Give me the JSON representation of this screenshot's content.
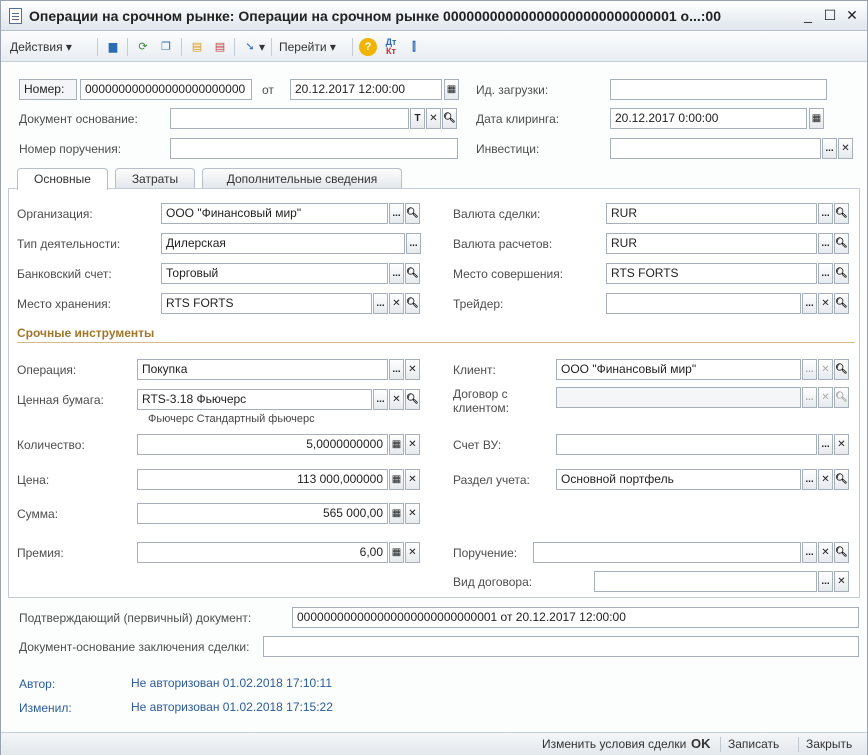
{
  "window": {
    "title": "Операции на срочном рынке: Операции на срочном рынке 000000000000000000000000000001 о...:00"
  },
  "toolbar": {
    "actions": "Действия",
    "goto": "Перейти"
  },
  "header": {
    "number_label": "Номер:",
    "number_value": "000000000000000000000000",
    "date_sep": "от",
    "date_value": "20.12.2017 12:00:00",
    "load_id_label": "Ид. загрузки:",
    "load_id_value": "",
    "basis_label": "Документ основание:",
    "basis_value": "",
    "clearing_label": "Дата клиринга:",
    "clearing_value": "20.12.2017  0:00:00",
    "order_label": "Номер поручения:",
    "order_value": "",
    "invest_label": "Инвестици:",
    "invest_value": ""
  },
  "tabs": [
    "Основные",
    "Затраты",
    "Дополнительные сведения"
  ],
  "main": {
    "org_label": "Организация:",
    "org_value": "ООО \"Финансовый мир\"",
    "activity_label": "Тип деятельности:",
    "activity_value": "Дилерская",
    "bank_label": "Банковский счет:",
    "bank_value": "Торговый",
    "storage_label": "Место хранения:",
    "storage_value": "RTS FORTS",
    "deal_currency_label": "Валюта сделки:",
    "deal_currency_value": "RUR",
    "settle_currency_label": "Валюта расчетов:",
    "settle_currency_value": "RUR",
    "venue_label": "Место совершения:",
    "venue_value": "RTS FORTS",
    "trader_label": "Трейдер:",
    "trader_value": "",
    "section": "Срочные инструменты",
    "operation_label": "Операция:",
    "operation_value": "Покупка",
    "security_label": "Ценная бумага:",
    "security_value": "RTS-3.18 Фьючерс",
    "security_note": "Фьючерс Стандартный фьючерс",
    "qty_label": "Количество:",
    "qty_value": "5,0000000000",
    "price_label": "Цена:",
    "price_value": "113 000,000000",
    "sum_label": "Сумма:",
    "sum_value": "565 000,00",
    "premium_label": "Премия:",
    "premium_value": "6,00",
    "client_label": "Клиент:",
    "client_value": "ООО \"Финансовый мир\"",
    "contract_label_1": "Договор с",
    "contract_label_2": "клиентом:",
    "contract_value": "",
    "account_label": "Счет ВУ:",
    "account_value": "",
    "section_label": "Раздел учета:",
    "section_value": "Основной портфель",
    "instruction_label": "Поручение:",
    "instruction_value": "",
    "contract_type_label": "Вид договора:",
    "contract_type_value": ""
  },
  "footer": {
    "confirm_label": "Подтверждающий (первичный) документ:",
    "confirm_value": "000000000000000000000000000001 от 20.12.2017 12:00:00",
    "deal_basis_label": "Документ-основание заключения сделки:",
    "deal_basis_value": "",
    "author_label": "Автор:",
    "author_value": "Не авторизован 01.02.2018 17:10:11",
    "changed_label": "Изменил:",
    "changed_value": "Не авторизован 01.02.2018 17:15:22"
  },
  "status": {
    "change": "Изменить условия сделки",
    "ok": "OK",
    "save": "Записать",
    "close": "Закрыть"
  }
}
